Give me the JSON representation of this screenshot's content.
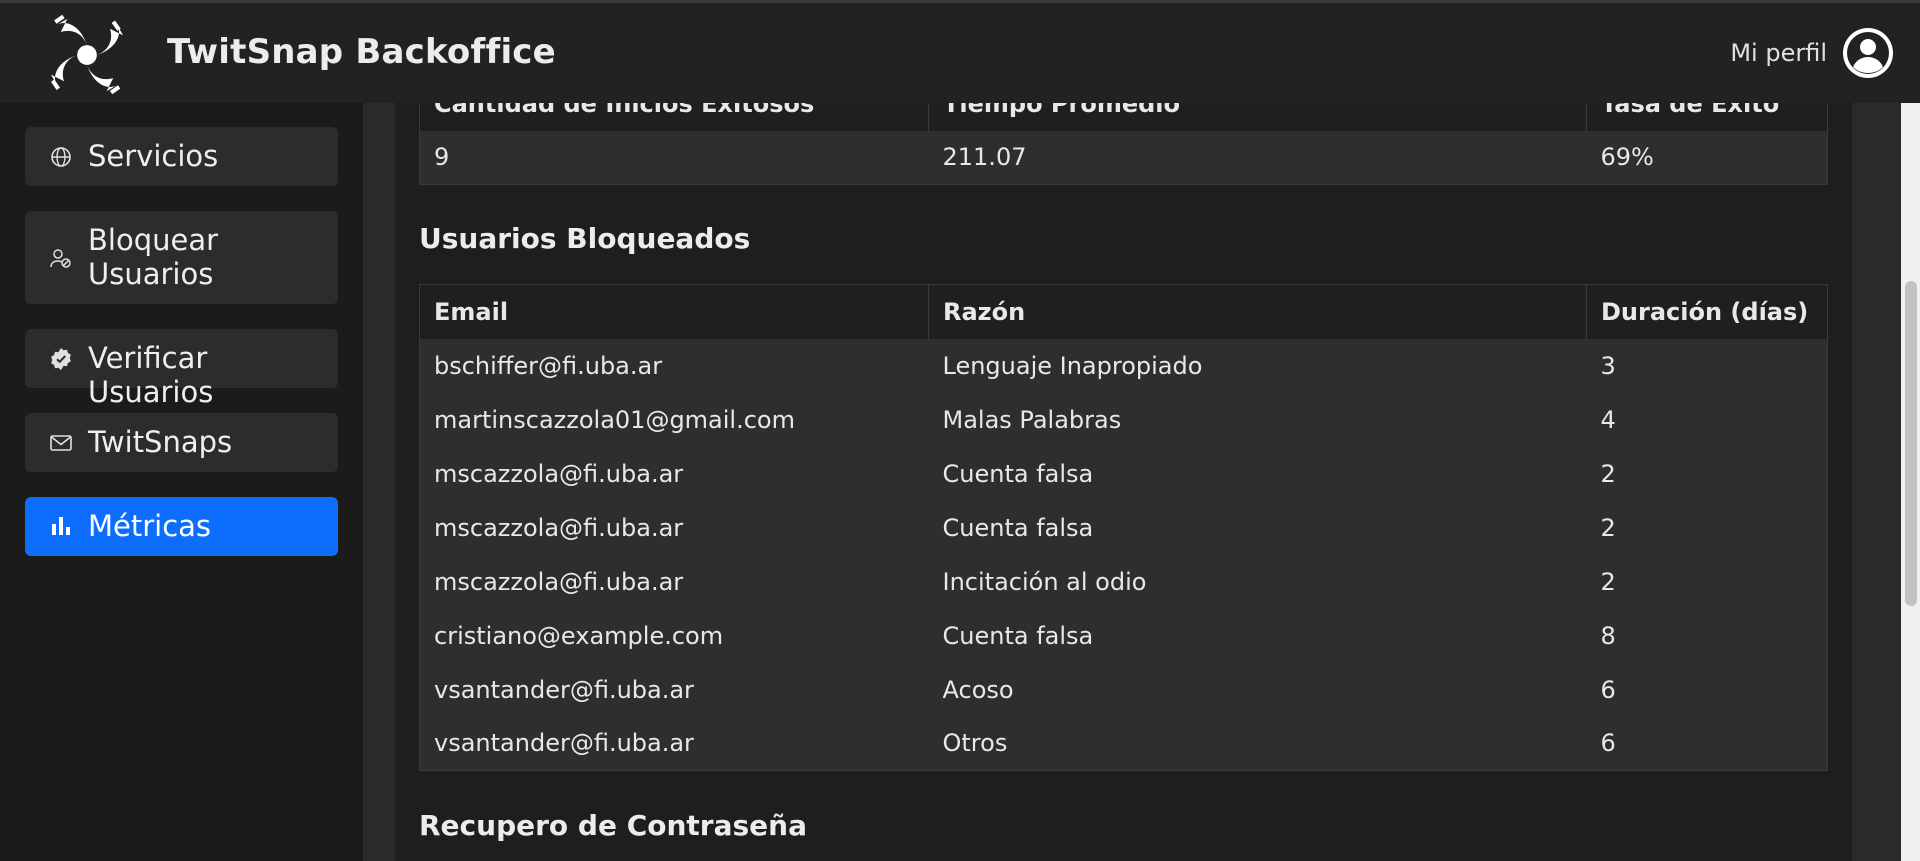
{
  "header": {
    "app_title": "TwitSnap Backoffice",
    "profile_label": "Mi perfil",
    "logo_icon": "twitsnap-logo",
    "avatar_icon": "user-circle-icon"
  },
  "sidebar": {
    "items": [
      {
        "label": "Servicios",
        "icon": "globe-icon",
        "active": false
      },
      {
        "label": "Bloquear Usuarios",
        "icon": "user-block-icon",
        "active": false
      },
      {
        "label": "Verificar Usuarios",
        "icon": "verified-badge-icon",
        "active": false
      },
      {
        "label": "TwitSnaps",
        "icon": "envelope-icon",
        "active": false
      },
      {
        "label": "Métricas",
        "icon": "bar-chart-icon",
        "active": true
      }
    ],
    "active_color": "#0d6efd"
  },
  "login_metrics": {
    "headers": [
      "Cantidad de Inicios Exitosos",
      "Tiempo Promedio",
      "Tasa de Éxito"
    ],
    "row": [
      "9",
      "211.07",
      "69%"
    ]
  },
  "blocked_users": {
    "title": "Usuarios Bloqueados",
    "headers": [
      "Email",
      "Razón",
      "Duración (días)"
    ],
    "rows": [
      [
        "bschiffer@fi.uba.ar",
        "Lenguaje Inapropiado",
        "3"
      ],
      [
        "martinscazzola01@gmail.com",
        "Malas Palabras",
        "4"
      ],
      [
        "mscazzola@fi.uba.ar",
        "Cuenta falsa",
        "2"
      ],
      [
        "mscazzola@fi.uba.ar",
        "Cuenta falsa",
        "2"
      ],
      [
        "mscazzola@fi.uba.ar",
        "Incitación al odio",
        "2"
      ],
      [
        "cristiano@example.com",
        "Cuenta falsa",
        "8"
      ],
      [
        "vsantander@fi.uba.ar",
        "Acoso",
        "6"
      ],
      [
        "vsantander@fi.uba.ar",
        "Otros",
        "6"
      ]
    ]
  },
  "password_recovery": {
    "title": "Recupero de Contraseña"
  }
}
